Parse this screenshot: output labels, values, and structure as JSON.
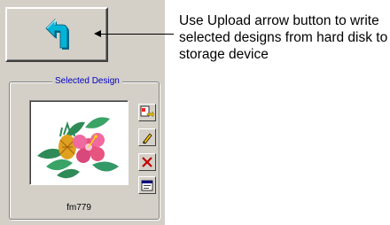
{
  "group": {
    "title": "Selected Design"
  },
  "design": {
    "filename": "fm779"
  },
  "callout": {
    "text": "Use Upload arrow button to write selected designs from hard disk to storage device"
  },
  "icons": {
    "upload": "upload-arrow-icon",
    "side": [
      "export-design-icon",
      "rename-design-icon",
      "delete-design-icon",
      "properties-icon"
    ]
  },
  "colors": {
    "panel": "#d4d0c8",
    "arrow": "#00a0c8",
    "group_title": "#0000c0",
    "delete": "#c00000"
  }
}
